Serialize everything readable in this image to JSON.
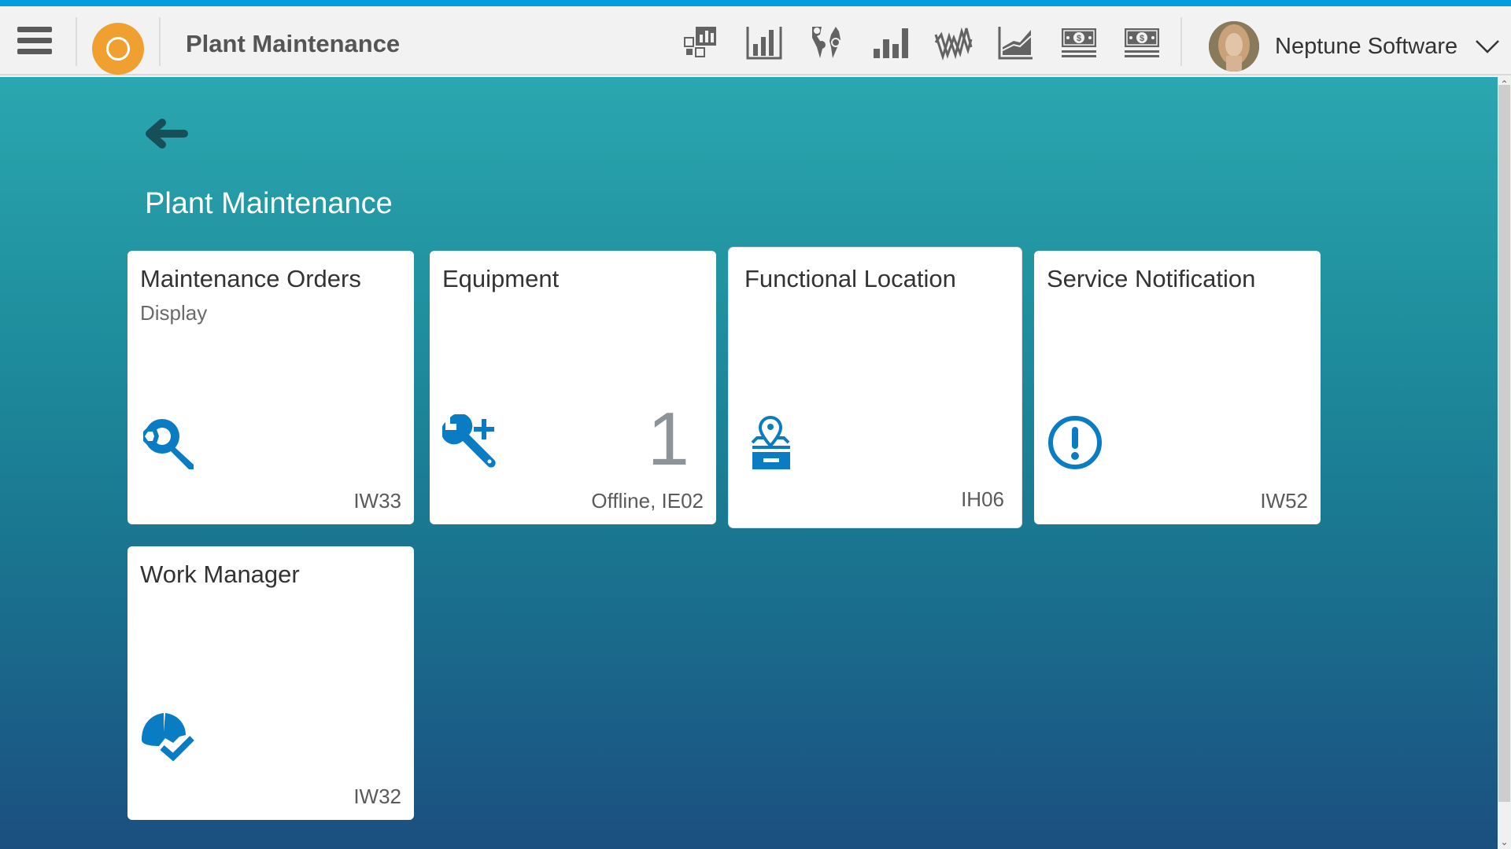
{
  "header": {
    "app_title": "Plant Maintenance",
    "menu_icon": "hamburger-menu-icon",
    "logo_icon": "circle-logo-icon",
    "toolbar_icons": [
      {
        "name": "dashboard-chart-icon"
      },
      {
        "name": "bar-chart-axis-icon"
      },
      {
        "name": "world-map-icon"
      },
      {
        "name": "bar-chart-icon"
      },
      {
        "name": "line-chart-zigzag-icon"
      },
      {
        "name": "area-chart-icon"
      },
      {
        "name": "money-bills-icon"
      },
      {
        "name": "money-bills-icon"
      }
    ],
    "user": {
      "name": "Neptune Software",
      "avatar": "user-avatar",
      "dropdown_icon": "chevron-down-icon"
    }
  },
  "page": {
    "back_icon": "back-arrow-icon",
    "title": "Plant Maintenance"
  },
  "tiles": [
    {
      "title": "Maintenance Orders",
      "subtitle": "Display",
      "icon": "wrench-search-icon",
      "number": "",
      "footer": "IW33"
    },
    {
      "title": "Equipment",
      "subtitle": "",
      "icon": "wrench-add-icon",
      "number": "1",
      "footer": "Offline, IE02"
    },
    {
      "title": "Functional Location",
      "subtitle": "",
      "icon": "location-box-icon",
      "number": "",
      "footer": "IH06"
    },
    {
      "title": "Service Notification",
      "subtitle": "",
      "icon": "alert-circle-icon",
      "number": "",
      "footer": "IW52"
    },
    {
      "title": "Work Manager",
      "subtitle": "",
      "icon": "helmet-check-icon",
      "number": "",
      "footer": "IW32"
    }
  ],
  "colors": {
    "accent": "#009de0",
    "tile_icon": "#0a7cc4",
    "logo": "#f0a030",
    "background_top": "#2aa7b0",
    "background_bottom": "#1b4f80"
  }
}
